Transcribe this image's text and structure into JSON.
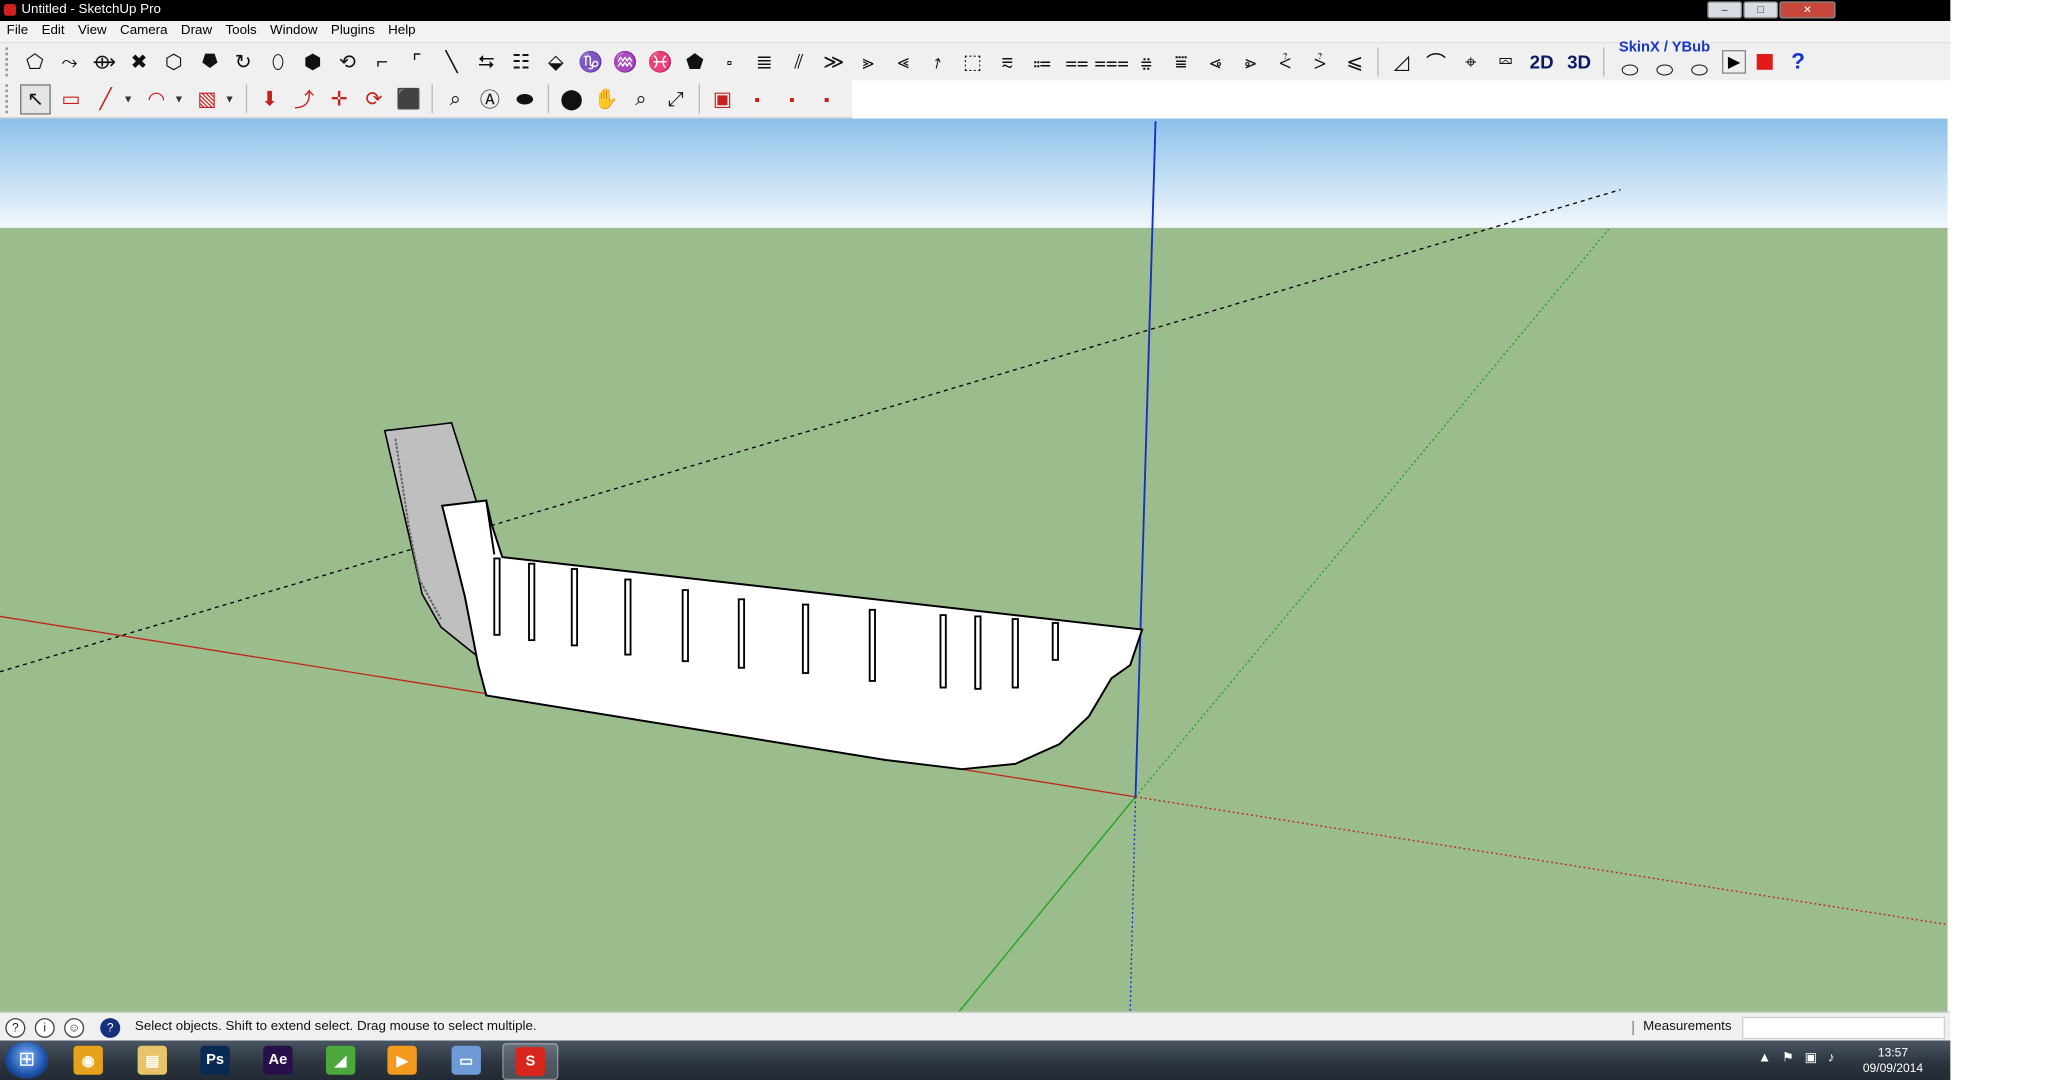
{
  "window": {
    "title": "Untitled - SketchUp Pro",
    "controls": {
      "minimize": "–",
      "maximize": "□",
      "close": "✕"
    }
  },
  "menu": [
    "File",
    "Edit",
    "View",
    "Camera",
    "Draw",
    "Tools",
    "Window",
    "Plugins",
    "Help"
  ],
  "toolbar_top": {
    "plugin_icons": [
      "⬠",
      "⤳",
      "⟴",
      "✖",
      "⬡",
      "⯂",
      "↻",
      "⬯",
      "⬢",
      "⟲",
      "⌐",
      "⌜",
      "╲",
      "⮀",
      "☷",
      "⬙",
      "♑",
      "♒",
      "♓",
      "⬟",
      "⬞",
      "≣",
      "⫽",
      "≫",
      "⪢",
      "⪡",
      "⭎",
      "⬚",
      "⩳",
      "⩴",
      "⩵",
      "⩶",
      "⩷",
      "⩸",
      "⩹",
      "⩺",
      "⩻",
      "⩼",
      "⩽"
    ],
    "view_icons": [
      "◿",
      "⌒",
      "⌖",
      "⮹"
    ],
    "btn_2d": "2D",
    "btn_3d": "3D",
    "skinx_label": "SkinX / YBub",
    "skinx_icons": [
      "⬭",
      "⬭",
      "⬭"
    ],
    "play": "▶",
    "help": "?"
  },
  "toolbar_main": {
    "select": "↖",
    "eraser": "▭",
    "pencil": "╱",
    "arc": "◠",
    "rect": "▧",
    "dropdown": "▼",
    "edit_icons": [
      "⬇",
      "⤴",
      "✛",
      "⟳",
      "⬛"
    ],
    "measure_icons": [
      "⌕",
      "Ⓐ",
      "⬬"
    ],
    "nav_icons": [
      "⬤",
      "✋",
      "⌕",
      "⤢"
    ],
    "component_icons": [
      "▣",
      "⬝",
      "⬝",
      "⬝"
    ]
  },
  "status": {
    "message": "Select objects. Shift to extend select. Drag mouse to select multiple.",
    "icons": [
      "?",
      "i",
      "☺",
      "?"
    ],
    "measurements_label": "Measurements",
    "measurements_value": ""
  },
  "taskbar": {
    "start": "⊞",
    "apps": [
      {
        "name": "chrome",
        "label": "◉",
        "color": "#e8a11a",
        "active": false
      },
      {
        "name": "explorer",
        "label": "▤",
        "color": "#e7c46a",
        "active": false
      },
      {
        "name": "photoshop",
        "label": "Ps",
        "color": "#0a2a56",
        "active": false
      },
      {
        "name": "after-effects",
        "label": "Ae",
        "color": "#28104a",
        "active": false
      },
      {
        "name": "camtasia",
        "label": "◢",
        "color": "#4da83c",
        "active": false
      },
      {
        "name": "media-player",
        "label": "▶",
        "color": "#f29a1e",
        "active": false
      },
      {
        "name": "window-app",
        "label": "▭",
        "color": "#6e9bd6",
        "active": false
      },
      {
        "name": "sketchup",
        "label": "S",
        "color": "#d8261e",
        "active": true
      }
    ],
    "tray_icons": [
      "▲",
      "⚑",
      "▣",
      "♪"
    ],
    "time": "13:57",
    "date": "09/09/2014"
  },
  "colors": {
    "sky_top": "#8cc0ea",
    "sky_bottom": "#f2f8fc",
    "ground": "#9bbc8c",
    "axis_red": "#c0251b",
    "axis_green": "#1da51d",
    "axis_blue": "#1531c4",
    "model_face": "#ffffff",
    "model_back_face": "#bfbfbf",
    "edge": "#000000"
  }
}
